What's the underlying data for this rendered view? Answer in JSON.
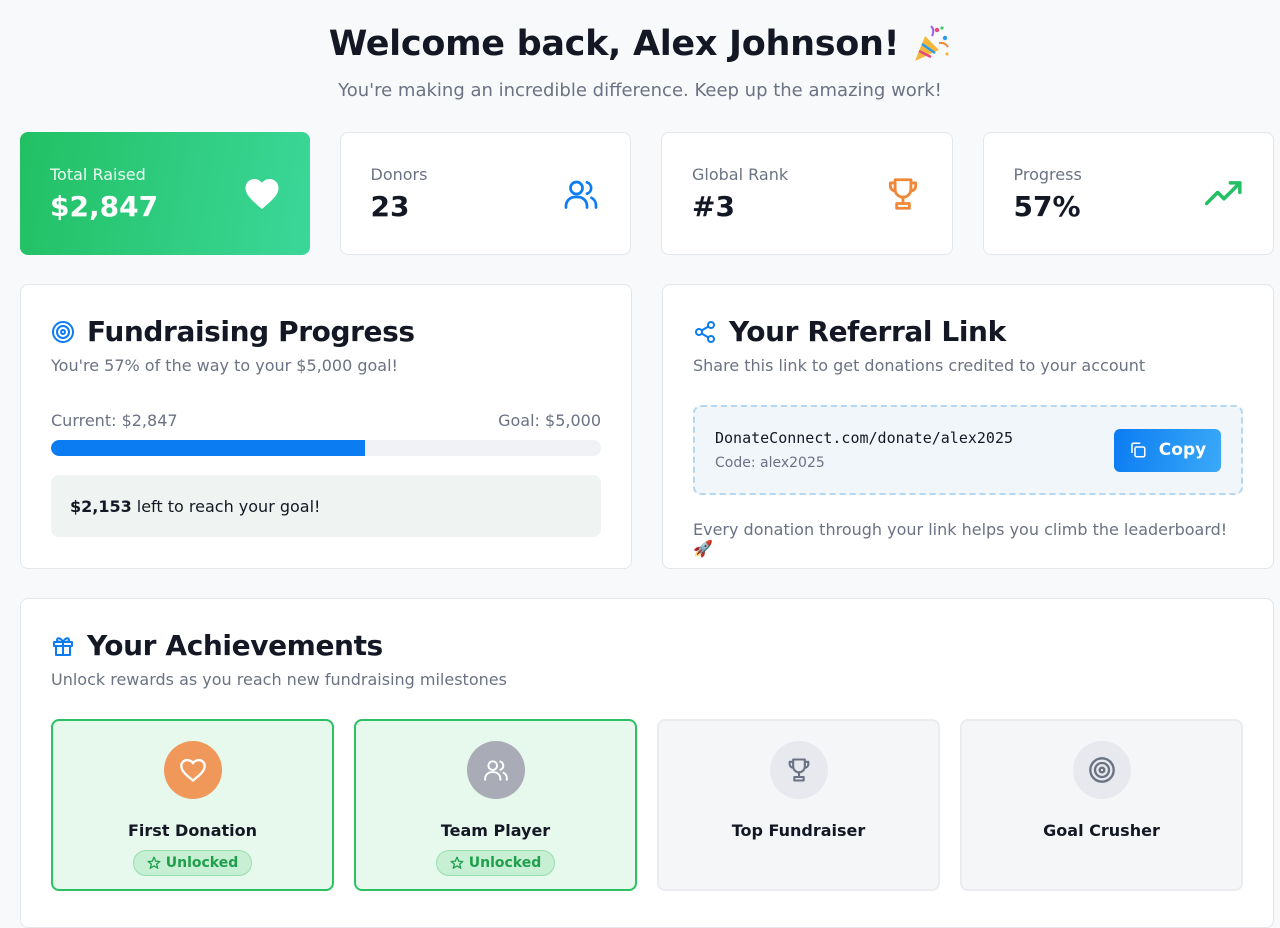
{
  "header": {
    "title": "Welcome back, Alex Johnson!",
    "subtitle": "You're making an incredible difference. Keep up the amazing work!",
    "title_icon": "party-popper-icon"
  },
  "stats": [
    {
      "label": "Total Raised",
      "value": "$2,847",
      "icon": "heart-icon",
      "accent": "#22c063"
    },
    {
      "label": "Donors",
      "value": "23",
      "icon": "users-icon",
      "accent": "#0b7cf2"
    },
    {
      "label": "Global Rank",
      "value": "#3",
      "icon": "trophy-icon",
      "accent": "#f0883a"
    },
    {
      "label": "Progress",
      "value": "57%",
      "icon": "trending-up-icon",
      "accent": "#22c063"
    }
  ],
  "progress": {
    "title": "Fundraising Progress",
    "subtitle": "You're 57% of the way to your $5,000 goal!",
    "current_label": "Current: $2,847",
    "goal_label": "Goal: $5,000",
    "fraction": 0.57,
    "remaining_amount": "$2,153",
    "remaining_text": "left to reach your goal!"
  },
  "referral": {
    "title": "Your Referral Link",
    "subtitle": "Share this link to get donations credited to your account",
    "url": "DonateConnect.com/donate/alex2025",
    "code": "Code: alex2025",
    "copy_label": "Copy",
    "note": "Every donation through your link helps you climb the leaderboard! 🚀"
  },
  "achievements": {
    "title": "Your Achievements",
    "subtitle": "Unlock rewards as you reach new fundraising milestones",
    "unlocked_label": "Unlocked",
    "items": [
      {
        "name": "First Donation",
        "unlocked": true,
        "icon": "heart-icon"
      },
      {
        "name": "Team Player",
        "unlocked": true,
        "icon": "users-icon"
      },
      {
        "name": "Top Fundraiser",
        "unlocked": false,
        "icon": "trophy-icon"
      },
      {
        "name": "Goal Crusher",
        "unlocked": false,
        "icon": "target-icon"
      }
    ]
  },
  "colors": {
    "primary_blue": "#0b7cf2",
    "success_green": "#22c063",
    "orange": "#f0883a"
  }
}
